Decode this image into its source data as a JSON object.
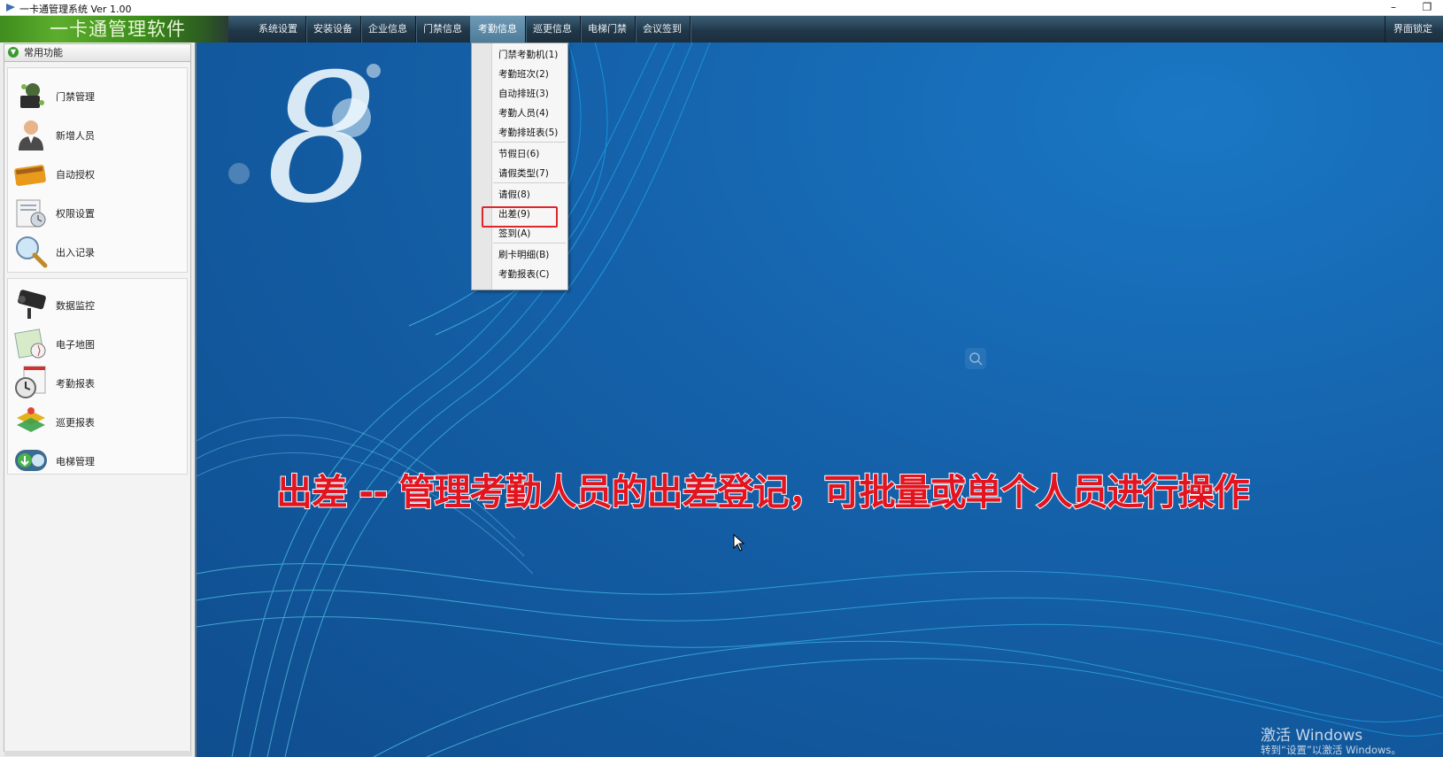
{
  "window": {
    "title": "一卡通管理系统  Ver 1.00",
    "minimize_glyph": "–",
    "restore_glyph": "❐"
  },
  "menubar": {
    "brand": "一卡通管理软件",
    "items": [
      {
        "label": "系统设置"
      },
      {
        "label": "安装设备"
      },
      {
        "label": "企业信息"
      },
      {
        "label": "门禁信息"
      },
      {
        "label": "考勤信息",
        "active": true
      },
      {
        "label": "巡更信息"
      },
      {
        "label": "电梯门禁"
      },
      {
        "label": "会议签到"
      }
    ],
    "lock_button": "界面锁定"
  },
  "sidebar": {
    "group_title": "常用功能",
    "items": [
      {
        "label": "门禁管理",
        "icon": "door-access-icon"
      },
      {
        "label": "新增人员",
        "icon": "person-icon"
      },
      {
        "label": "自动授权",
        "icon": "card-icon"
      },
      {
        "label": "权限设置",
        "icon": "permission-icon"
      },
      {
        "label": "出入记录",
        "icon": "magnifier-icon"
      },
      {
        "label": "数据监控",
        "icon": "camera-icon"
      },
      {
        "label": "电子地图",
        "icon": "map-icon"
      },
      {
        "label": "考勤报表",
        "icon": "clock-icon"
      },
      {
        "label": "巡更报表",
        "icon": "layers-icon"
      },
      {
        "label": "电梯管理",
        "icon": "elevator-icon"
      }
    ]
  },
  "dropdown": {
    "items": [
      {
        "label": "门禁考勤机(1)"
      },
      {
        "label": "考勤班次(2)"
      },
      {
        "label": "自动排班(3)"
      },
      {
        "label": "考勤人员(4)"
      },
      {
        "label": "考勤排班表(5)"
      },
      {
        "label": "节假日(6)"
      },
      {
        "label": "请假类型(7)"
      },
      {
        "label": "请假(8)"
      },
      {
        "label": "出差(9)",
        "highlighted": true
      },
      {
        "label": "签到(A)"
      },
      {
        "label": "刷卡明细(B)"
      },
      {
        "label": "考勤报表(C)"
      }
    ]
  },
  "overlay": {
    "caption": "出差 -- 管理考勤人员的出差登记，可批量或单个人员进行操作",
    "watermark_title": "激活 Windows",
    "watermark_sub": "转到“设置”以激活 Windows。",
    "logo_text": "8"
  },
  "colors": {
    "highlight_border": "#e0262d",
    "caption_text": "#e2141f",
    "brand_green": "#5cad2d",
    "menubar_dark": "#21384a"
  }
}
